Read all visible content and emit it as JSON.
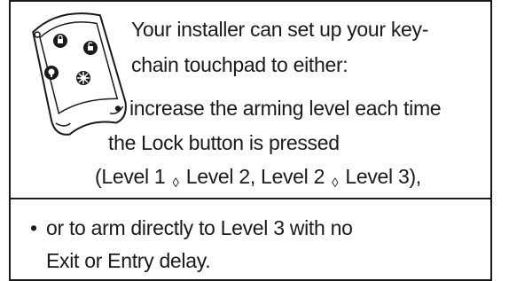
{
  "intro": {
    "line1": "Your installer can set up your key-",
    "line2": "chain touchpad to either:"
  },
  "option1": {
    "bullet": "•",
    "line1": "increase the arming level each time",
    "line2": "the Lock button is pressed",
    "levels": {
      "open": "(Level 1",
      "arrow1": "◊",
      "mid": "Level 2, Level 2",
      "arrow2": "◊",
      "close": "Level 3),"
    }
  },
  "option2": {
    "bullet": "•",
    "line1": "or to arm directly to Level 3 with no",
    "line2": "Exit or Entry delay."
  },
  "keyfob": {
    "icon": "keychain-touchpad-icon",
    "buttons": [
      "lock-icon",
      "unlock-icon",
      "light-icon",
      "star-icon"
    ]
  }
}
